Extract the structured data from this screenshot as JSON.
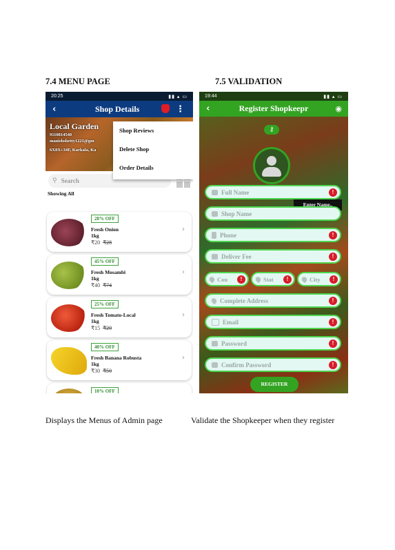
{
  "headings": {
    "left": "7.4 MENU PAGE",
    "right": "7.5 VALIDATION"
  },
  "captions": {
    "left": "Displays the Menus of Admin page",
    "right": "Validate the Shopkeeper when they register"
  },
  "menu_screen": {
    "status_time": "20:25",
    "status_icons": "་ Vo) °°° LTE1 ▂▄▆ ▭",
    "title": "Shop Details",
    "shop": {
      "name": "Local Garden",
      "phone": "9110814540",
      "email": "manishshetty1221@gm",
      "address": "6X8X+34F, Karkala, Ka"
    },
    "menu_items": [
      "Shop Reviews",
      "Delete Shop",
      "Order Details"
    ],
    "search_placeholder": "Search",
    "showing_label": "Showing All",
    "products": [
      {
        "badge": "28% OFF",
        "name": "Fresh Onion",
        "qty": "1kg",
        "price": "₹20",
        "old_price": "₹28",
        "color": "#7b2d3a"
      },
      {
        "badge": "45% OFF",
        "name": "Fresh Mosambi",
        "qty": "1kg",
        "price": "₹40",
        "old_price": "₹74",
        "color": "#7fa52a"
      },
      {
        "badge": "25% OFF",
        "name": "Fresh Tomato-Local",
        "qty": "1kg",
        "price": "₹15",
        "old_price": "₹20",
        "color": "#d93a1c"
      },
      {
        "badge": "40% OFF",
        "name": "Fresh Banana Robusta",
        "qty": "1kg",
        "price": "₹30",
        "old_price": "₹50",
        "color": "#f2c40f"
      },
      {
        "badge": "10% OFF",
        "name": "",
        "qty": "",
        "price": "",
        "old_price": "",
        "color": "#e0b64a"
      }
    ]
  },
  "register_screen": {
    "status_time": "19:44",
    "title": "Register Shopkeepr",
    "tooltip": "Enter Name..",
    "fields": {
      "full_name": "Full Name",
      "shop_name": "Shop Name",
      "phone": "Phone",
      "deliver_fee": "Deliver Fee",
      "country": "Cou",
      "state": "Stat",
      "city": "City",
      "address": "Complete Address",
      "email": "Email",
      "password": "Password",
      "confirm_password": "Confirm Password"
    },
    "error_glyph": "!",
    "register_label": "REGISTER"
  },
  "colors": {
    "menu_appbar": "#0d3b80",
    "register_appbar": "#33a322",
    "field_border": "#4dd64d",
    "error": "#d81b28"
  }
}
